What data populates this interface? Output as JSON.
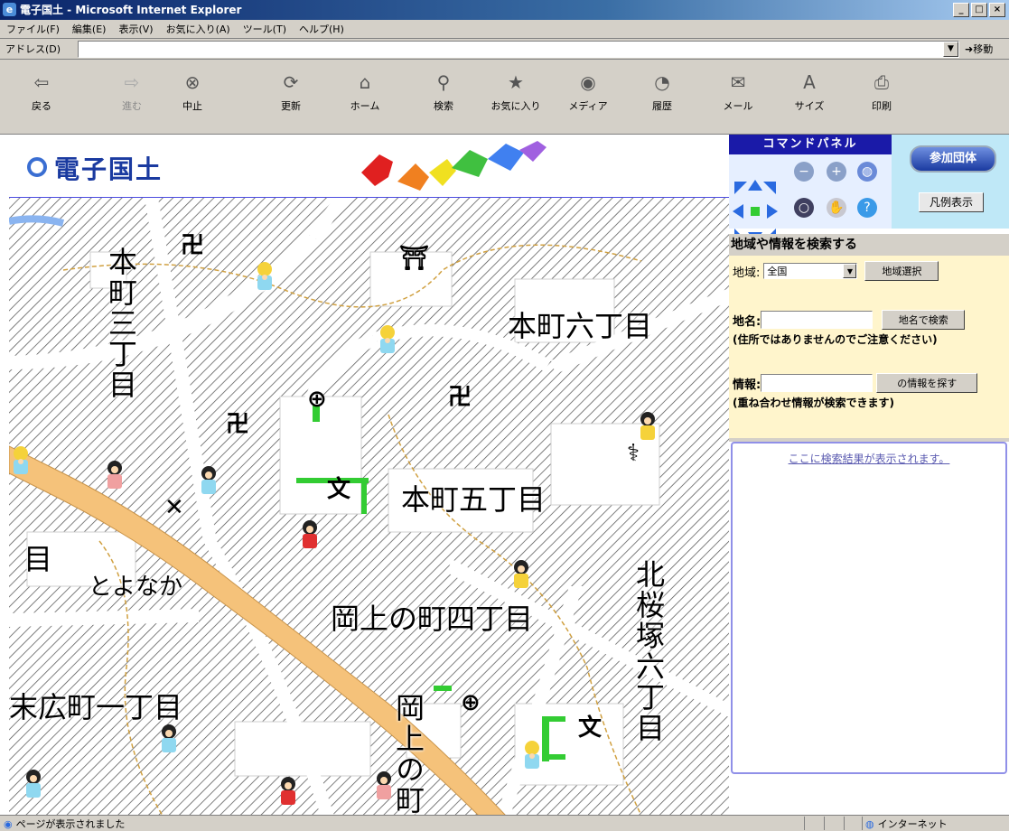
{
  "window": {
    "title": "電子国土 - Microsoft Internet Explorer"
  },
  "menu": [
    "ファイル(F)",
    "編集(E)",
    "表示(V)",
    "お気に入り(A)",
    "ツール(T)",
    "ヘルプ(H)"
  ],
  "address": {
    "label": "アドレス(D)",
    "value": "",
    "go": "移動"
  },
  "toolbar": [
    {
      "label": "戻る",
      "icon": "back-icon"
    },
    {
      "label": "進む",
      "icon": "forward-icon"
    },
    {
      "label": "中止",
      "icon": "stop-icon"
    },
    {
      "label": "更新",
      "icon": "refresh-icon"
    },
    {
      "label": "ホーム",
      "icon": "home-icon"
    },
    {
      "label": "検索",
      "icon": "search-icon"
    },
    {
      "label": "お気に入り",
      "icon": "favorites-icon"
    },
    {
      "label": "メディア",
      "icon": "media-icon"
    },
    {
      "label": "履歴",
      "icon": "history-icon"
    },
    {
      "label": "メール",
      "icon": "mail-icon"
    },
    {
      "label": "サイズ",
      "icon": "font-size-icon"
    },
    {
      "label": "印刷",
      "icon": "print-icon"
    }
  ],
  "site": {
    "logo": "電子国土"
  },
  "map": {
    "labels": [
      {
        "text": "本町三丁目",
        "vertical": true
      },
      {
        "text": "本町六丁目",
        "vertical": false
      },
      {
        "text": "本町五丁目",
        "vertical": false
      },
      {
        "text": "目",
        "vertical": false
      },
      {
        "text": "とよなか",
        "vertical": false
      },
      {
        "text": "岡上の町四丁目",
        "vertical": false
      },
      {
        "text": "北桜塚六丁目",
        "vertical": true
      },
      {
        "text": "末広町一丁目",
        "vertical": false
      },
      {
        "text": "岡上の町",
        "vertical": true
      }
    ]
  },
  "panel": {
    "command_title": "コマンドパネル",
    "participants_button": "参加団体",
    "legend_button": "凡例表示",
    "search_header": "地域や情報を検索する",
    "region_label": "地域:",
    "region_value": "全国",
    "region_button": "地域選択",
    "placename_label": "地名:",
    "placename_value": "",
    "placename_button": "地名で検索",
    "placename_note": "(住所ではありませんのでご注意ください)",
    "info_label": "情報:",
    "info_value": "",
    "info_button": "の情報を探す",
    "info_note": "(重ね合わせ情報が検索できます)",
    "results_message": "ここに検索結果が表示されます。"
  },
  "status": {
    "left": "ページが表示されました",
    "zone": "インターネット"
  }
}
